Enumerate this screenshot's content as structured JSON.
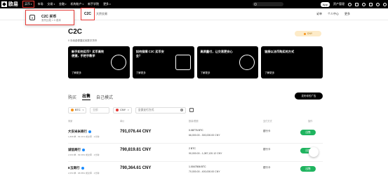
{
  "topbar": {
    "logo": "欧易",
    "nav": [
      {
        "label": "买币",
        "active": true
      },
      {
        "label": "市场"
      },
      {
        "label": "交易"
      },
      {
        "label": "金融"
      },
      {
        "label": "机构账户"
      },
      {
        "label": "新手学院"
      },
      {
        "label": "更多"
      }
    ],
    "right": {
      "download": "App",
      "assets": "资产管理"
    }
  },
  "subnav": {
    "c2c": "C2C",
    "bulk": "大宗交易",
    "links": [
      "订单",
      "个人中心",
      "更多"
    ]
  },
  "dropdown": {
    "title": "C2C 买币",
    "desc": "丢失比较 > 0 成本"
  },
  "page": {
    "title": "C2C",
    "tagline": "0 手续费便捷买卖数字货币",
    "currency": "CNY"
  },
  "banners": [
    {
      "title": "新手如何买币？买币高效便捷，手把手教学",
      "link": "了解更多"
    },
    {
      "title": "如何保障 C2C 买币安全？",
      "link": "了解更多"
    },
    {
      "title": "高质量付，让交易更安心",
      "link": "了解更多"
    },
    {
      "title": "链接以法币购买的方式",
      "link": "了解更多"
    }
  ],
  "tabs": [
    {
      "label": "购买"
    },
    {
      "label": "出售",
      "active": true
    },
    {
      "label": "自己模式"
    }
  ],
  "post_button": "发布你的广告",
  "filters": {
    "coin": "BTC",
    "amount_placeholder": "金额",
    "fiat": "CNY",
    "payment_placeholder": "全部支付方式"
  },
  "table": {
    "headers": [
      "商家",
      "单价",
      "数量/限额",
      "支付方式",
      "操作"
    ],
    "rows": [
      {
        "name": "大安米米商行",
        "meta": "1,898 单 · 99.41% 成交率 · 1分钟",
        "price": "791,076.44 CNY",
        "avail": "0.08776 BTC",
        "limit": "66,000.00 - 300,000.00 CNY",
        "pay": "银行卡",
        "action": "出售"
      },
      {
        "name": "诚信商行",
        "meta": "2,060 单 · 99.69% 成交率 · 1分钟",
        "price": "790,819.81 CNY",
        "avail": "2 BTC",
        "limit": "90,000.00 - 1,087,120.12 CNY",
        "pay": "银行卡",
        "action": "出售"
      },
      {
        "name": "E玉商行",
        "meta": "2,050 单 · 98.88% 成交率 · 1分钟",
        "price": "790,364.61 CNY",
        "avail": "1.0047506 BTC",
        "limit": "70,000.00 - 400,000.00 CNY",
        "pay": "银行卡",
        "action": "出售"
      }
    ]
  }
}
